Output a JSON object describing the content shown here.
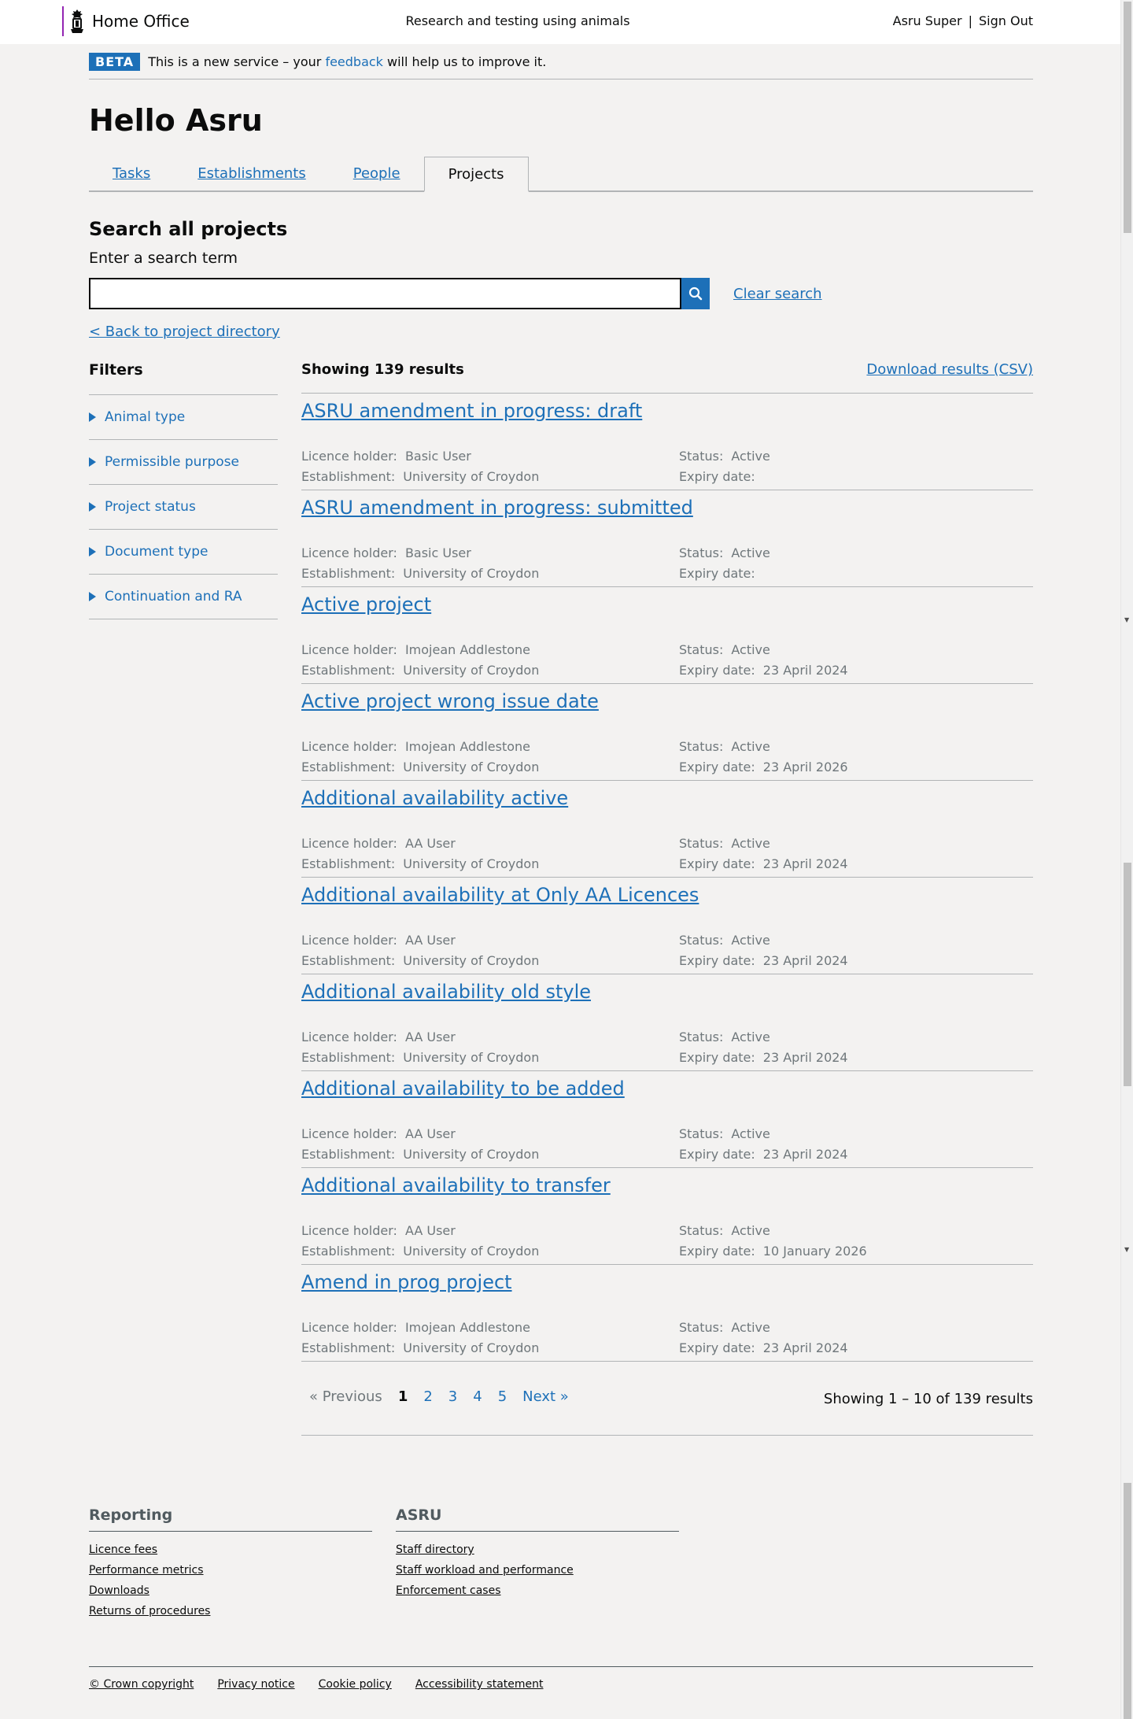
{
  "header": {
    "logo_text": "Home Office",
    "service_name": "Research and testing using animals",
    "user_name": "Asru Super",
    "separator": "|",
    "sign_out": "Sign Out"
  },
  "beta": {
    "tag": "BETA",
    "text_before": "This is a new service – your ",
    "feedback_link": "feedback",
    "text_after": " will help us to improve it."
  },
  "page_title": "Hello Asru",
  "tabs": [
    {
      "label": "Tasks",
      "selected": false
    },
    {
      "label": "Establishments",
      "selected": false
    },
    {
      "label": "People",
      "selected": false
    },
    {
      "label": "Projects",
      "selected": true
    }
  ],
  "search": {
    "heading": "Search all projects",
    "label": "Enter a search term",
    "value": "",
    "placeholder": "",
    "clear_label": "Clear search",
    "back_link": "< Back to project directory"
  },
  "filters": {
    "heading": "Filters",
    "items": [
      "Animal type",
      "Permissible purpose",
      "Project status",
      "Document type",
      "Continuation and RA"
    ]
  },
  "results": {
    "count_text": "Showing 139 results",
    "download_label": "Download results (CSV)",
    "labels": {
      "licence_holder": "Licence holder:",
      "establishment": "Establishment:",
      "status": "Status:",
      "expiry": "Expiry date:"
    },
    "items": [
      {
        "title": "ASRU amendment in progress: draft",
        "licence_holder": "Basic User",
        "establishment": "University of Croydon",
        "status": "Active",
        "expiry": ""
      },
      {
        "title": "ASRU amendment in progress: submitted",
        "licence_holder": "Basic User",
        "establishment": "University of Croydon",
        "status": "Active",
        "expiry": ""
      },
      {
        "title": "Active project",
        "licence_holder": "Imojean Addlestone",
        "establishment": "University of Croydon",
        "status": "Active",
        "expiry": "23 April 2024"
      },
      {
        "title": "Active project wrong issue date",
        "licence_holder": "Imojean Addlestone",
        "establishment": "University of Croydon",
        "status": "Active",
        "expiry": "23 April 2026"
      },
      {
        "title": "Additional availability active",
        "licence_holder": "AA User",
        "establishment": "University of Croydon",
        "status": "Active",
        "expiry": "23 April 2024"
      },
      {
        "title": "Additional availability at Only AA Licences",
        "licence_holder": "AA User",
        "establishment": "University of Croydon",
        "status": "Active",
        "expiry": "23 April 2024"
      },
      {
        "title": "Additional availability old style",
        "licence_holder": "AA User",
        "establishment": "University of Croydon",
        "status": "Active",
        "expiry": "23 April 2024"
      },
      {
        "title": "Additional availability to be added",
        "licence_holder": "AA User",
        "establishment": "University of Croydon",
        "status": "Active",
        "expiry": "23 April 2024"
      },
      {
        "title": "Additional availability to transfer",
        "licence_holder": "AA User",
        "establishment": "University of Croydon",
        "status": "Active",
        "expiry": "10 January 2026"
      },
      {
        "title": "Amend in prog project",
        "licence_holder": "Imojean Addlestone",
        "establishment": "University of Croydon",
        "status": "Active",
        "expiry": "23 April 2024"
      }
    ]
  },
  "pagination": {
    "previous": "« Previous",
    "pages": [
      "1",
      "2",
      "3",
      "4",
      "5"
    ],
    "current": "1",
    "next": "Next »",
    "summary": "Showing 1 – 10 of 139 results"
  },
  "footer": {
    "columns": [
      {
        "heading": "Reporting",
        "links": [
          "Licence fees",
          "Performance metrics",
          "Downloads",
          "Returns of procedures"
        ]
      },
      {
        "heading": "ASRU",
        "links": [
          "Staff directory",
          "Staff workload and performance",
          "Enforcement cases"
        ]
      }
    ],
    "bottom_links": [
      "© Crown copyright",
      "Privacy notice",
      "Cookie policy",
      "Accessibility statement"
    ]
  },
  "icons": {
    "crest": "royal-crest-icon",
    "search": "search-icon",
    "filter_toggle": "triangle-right-icon"
  },
  "colors": {
    "link": "#1d70b8",
    "beta_tag": "#1d70b8",
    "logo_bar": "#9325b2",
    "muted_text": "#6f777b",
    "page_bg": "#f3f2f1"
  }
}
